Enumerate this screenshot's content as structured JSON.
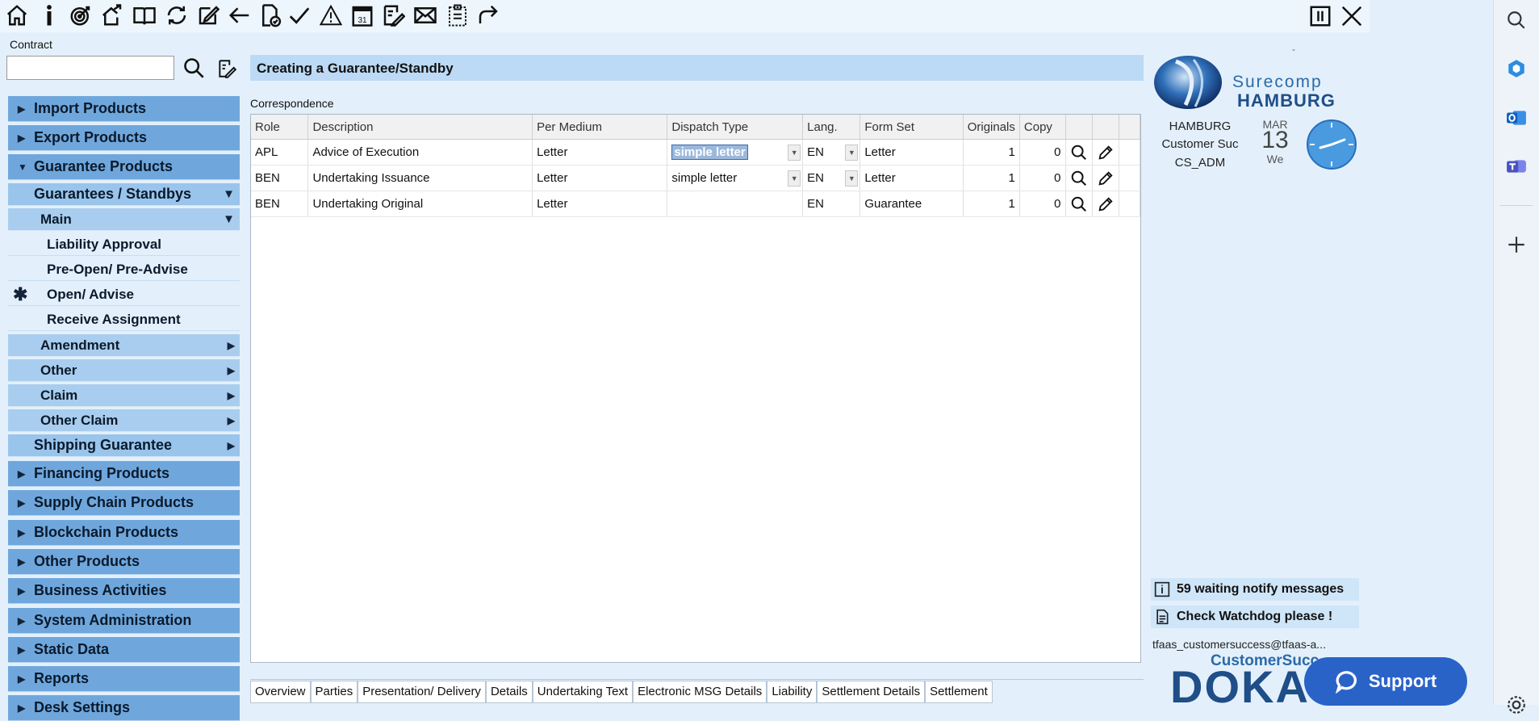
{
  "toolbar": {
    "icons": [
      "home-icon",
      "info-icon",
      "target-icon",
      "export-house-icon",
      "book-icon",
      "sync-icon",
      "edit-icon",
      "back-arrow-icon",
      "document-check-icon",
      "checkmark-icon",
      "warning-icon",
      "calendar-icon",
      "document-edit-icon",
      "mail-icon",
      "clipboard-icon",
      "redo-icon"
    ],
    "calendar_day": "31"
  },
  "contract": {
    "label": "Contract",
    "value": ""
  },
  "nav": [
    {
      "label": "Import Products",
      "level": 0,
      "state": "collapsed"
    },
    {
      "label": "Export Products",
      "level": 0,
      "state": "collapsed"
    },
    {
      "label": "Guarantee Products",
      "level": 0,
      "state": "expanded"
    },
    {
      "label": "Guarantees / Standbys",
      "level": 1,
      "state": "expanded"
    },
    {
      "label": "Main",
      "level": 2,
      "state": "expanded"
    },
    {
      "label": "Liability Approval",
      "level": 3
    },
    {
      "label": "Pre-Open/ Pre-Advise",
      "level": 3
    },
    {
      "label": "Open/ Advise",
      "level": 3,
      "current": true
    },
    {
      "label": "Receive Assignment",
      "level": 3
    },
    {
      "label": "Amendment",
      "level": 2,
      "state": "collapsed"
    },
    {
      "label": "Other",
      "level": 2,
      "state": "collapsed"
    },
    {
      "label": "Claim",
      "level": 2,
      "state": "collapsed"
    },
    {
      "label": "Other Claim",
      "level": 2,
      "state": "collapsed"
    },
    {
      "label": "Shipping Guarantee",
      "level": 1,
      "state": "collapsed"
    },
    {
      "label": "Financing Products",
      "level": 0,
      "state": "collapsed"
    },
    {
      "label": "Supply Chain Products",
      "level": 0,
      "state": "collapsed"
    },
    {
      "label": "Blockchain Products",
      "level": 0,
      "state": "collapsed"
    },
    {
      "label": "Other Products",
      "level": 0,
      "state": "collapsed"
    },
    {
      "label": "Business Activities",
      "level": 0,
      "state": "collapsed"
    },
    {
      "label": "System Administration",
      "level": 0,
      "state": "collapsed"
    },
    {
      "label": "Static Data",
      "level": 0,
      "state": "collapsed"
    },
    {
      "label": "Reports",
      "level": 0,
      "state": "collapsed"
    },
    {
      "label": "Desk Settings",
      "level": 0,
      "state": "collapsed"
    }
  ],
  "main": {
    "title": "Creating a Guarantee/Standby",
    "section": "Correspondence",
    "columns": [
      "Role",
      "Description",
      "Per Medium",
      "Dispatch Type",
      "Lang.",
      "Form Set",
      "Originals",
      "Copy"
    ],
    "rows": [
      {
        "role": "APL",
        "description": "Advice of Execution",
        "medium": "Letter",
        "dispatch": "simple letter",
        "lang": "EN",
        "form": "Letter",
        "orig": "1",
        "copy": "0"
      },
      {
        "role": "BEN",
        "description": "Undertaking Issuance",
        "medium": "Letter",
        "dispatch": "simple letter",
        "lang": "EN",
        "form": "Letter",
        "orig": "1",
        "copy": "0"
      },
      {
        "role": "BEN",
        "description": "Undertaking Original",
        "medium": "Letter",
        "dispatch": "",
        "lang": "EN",
        "form": "Guarantee",
        "orig": "1",
        "copy": "0"
      }
    ],
    "tabs": [
      "Overview",
      "Parties",
      "Presentation/ Delivery",
      "Details",
      "Undertaking Text",
      "Electronic MSG Details",
      "Liability",
      "Settlement Details",
      "Settlement"
    ]
  },
  "right": {
    "brand_top": "Surecomp",
    "brand_bottom": "HAMBURG",
    "dash": "-",
    "user_lines": [
      "HAMBURG",
      "Customer Suc",
      "CS_ADM"
    ],
    "cal_month": "MAR",
    "cal_day": "13",
    "cal_weekday": "We",
    "notif_messages": "59 waiting notify messages",
    "notif_watchdog": "Check Watchdog please !",
    "email": "tfaas_customersuccess@tfaas-a...",
    "logo_sub": "CustomerSucc",
    "logo_main": "DOKA",
    "support_label": "Support"
  },
  "colors": {
    "nav_level0": "#6fa7dd",
    "nav_level1": "#99c4ec",
    "background": "#e3f0fb",
    "support": "#2a63c8",
    "brand": "#1f4e88"
  }
}
